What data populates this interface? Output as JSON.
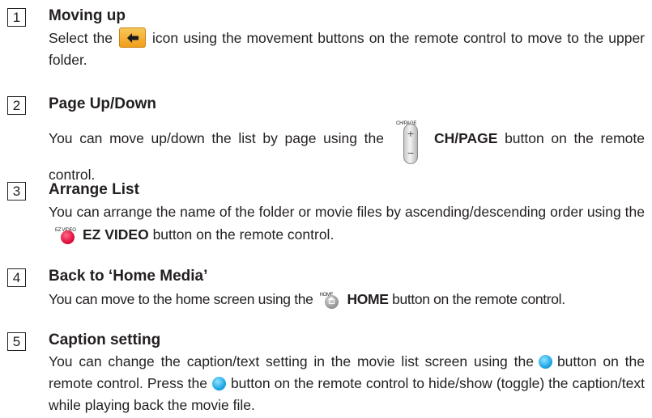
{
  "sections": [
    {
      "number": "1",
      "title": "Moving up",
      "text_a": "Select the",
      "text_b": "icon using the movement buttons on the remote control to move to the upper folder."
    },
    {
      "number": "2",
      "title": "Page Up/Down",
      "text_a": "You can move up/down the list by page using the",
      "button_label": "CH/PAGE",
      "icon_label": "CH/PAGE",
      "text_b": "button on the remote control."
    },
    {
      "number": "3",
      "title": "Arrange List",
      "text_a": "You can arrange the name of the folder or movie files by ascending/descending order using the",
      "button_label": "EZ VIDEO",
      "icon_label": "EZ VIDEO",
      "text_b": "button on the remote control."
    },
    {
      "number": "4",
      "title": "Back to ‘Home Media’",
      "text_a": "You can move to the home screen using the",
      "button_label": "HOME",
      "icon_label": "HOME",
      "text_b": "button on the remote control."
    },
    {
      "number": "5",
      "title": "Caption setting",
      "text_a": "You can change the caption/text setting in the movie list screen using the",
      "text_b": "button on the remote control. Press the",
      "text_c": "button on the remote control to hide/show (toggle) the caption/text while playing back the movie file."
    }
  ],
  "colors": {
    "folder_icon": "#f29d1a",
    "ez_video_button": "#e0103c",
    "home_button": "#9a9a9a",
    "caption_button": "#1fa7e6"
  }
}
